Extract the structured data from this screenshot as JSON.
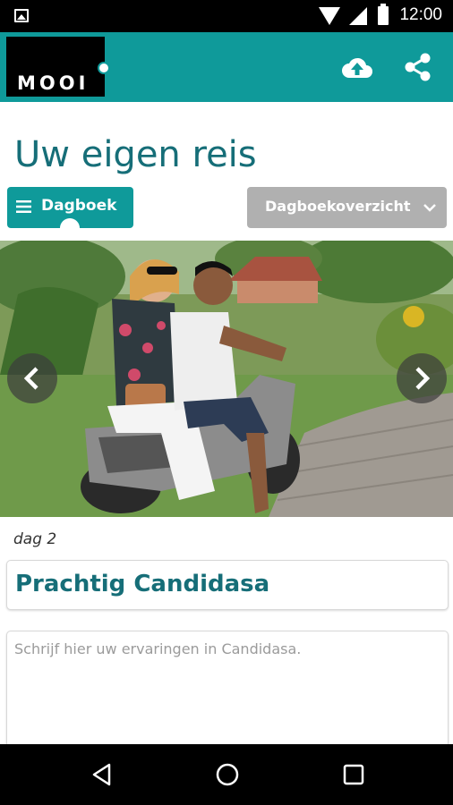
{
  "status_bar": {
    "time": "12:00",
    "icons": [
      "image-notification-icon",
      "wifi-icon",
      "signal-icon",
      "battery-icon"
    ]
  },
  "app_bar": {
    "logo_text": "MOOI",
    "background_color": "#0f9a9a",
    "actions": [
      "cloud-upload-icon",
      "share-icon"
    ]
  },
  "page": {
    "title": "Uw eigen reis",
    "title_color": "#166e78"
  },
  "toolbar": {
    "dagboek_label": "Dagboek",
    "overzicht_label": "Dagboekoverzicht"
  },
  "gallery": {
    "image_alt_icon": "photo-scooter-image",
    "prev_icon": "chevron-left-icon",
    "next_icon": "chevron-right-icon"
  },
  "entry": {
    "day_label": "dag 2",
    "title_value": "Prachtig Candidasa",
    "text_placeholder": "Schrijf hier uw ervaringen in Candidasa."
  },
  "nav_bar": {
    "icons": [
      "back-icon",
      "home-icon",
      "recent-apps-icon"
    ]
  }
}
